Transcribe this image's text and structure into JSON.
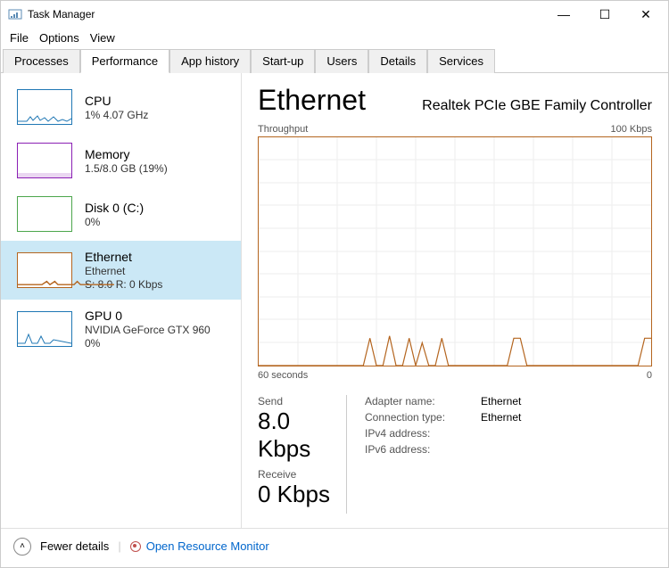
{
  "window": {
    "title": "Task Manager",
    "controls": {
      "min": "—",
      "max": "☐",
      "close": "✕"
    }
  },
  "menu": {
    "file": "File",
    "options": "Options",
    "view": "View"
  },
  "tabs": {
    "processes": "Processes",
    "performance": "Performance",
    "app_history": "App history",
    "startup": "Start-up",
    "users": "Users",
    "details": "Details",
    "services": "Services"
  },
  "sidebar": {
    "cpu": {
      "title": "CPU",
      "sub": "1%  4.07 GHz"
    },
    "memory": {
      "title": "Memory",
      "sub": "1.5/8.0 GB (19%)"
    },
    "disk": {
      "title": "Disk 0 (C:)",
      "sub": "0%"
    },
    "ethernet": {
      "title": "Ethernet",
      "sub1": "Ethernet",
      "sub2": "S: 8.0  R: 0 Kbps"
    },
    "gpu": {
      "title": "GPU 0",
      "sub1": "NVIDIA GeForce GTX 960",
      "sub2": "0%"
    }
  },
  "main": {
    "title": "Ethernet",
    "adapter": "Realtek PCIe GBE Family Controller",
    "chart_top_left": "Throughput",
    "chart_top_right": "100 Kbps",
    "chart_bottom_left": "60 seconds",
    "chart_bottom_right": "0",
    "send_label": "Send",
    "send_value": "8.0 Kbps",
    "receive_label": "Receive",
    "receive_value": "0 Kbps",
    "info": {
      "adapter_name_label": "Adapter name:",
      "adapter_name": "Ethernet",
      "conn_type_label": "Connection type:",
      "conn_type": "Ethernet",
      "ipv4_label": "IPv4 address:",
      "ipv4": "",
      "ipv6_label": "IPv6 address:",
      "ipv6": ""
    }
  },
  "footer": {
    "fewer": "Fewer details",
    "resource_monitor": "Open Resource Monitor"
  },
  "chart_data": {
    "type": "line",
    "title": "Throughput",
    "xlabel": "60 seconds",
    "ylabel": "",
    "ylim": [
      0,
      100
    ],
    "x_range": [
      60,
      0
    ],
    "series": [
      {
        "name": "Send",
        "color": "#b4651f",
        "x": [
          60,
          44,
          43,
          42,
          41,
          40,
          39,
          38,
          37,
          36,
          35,
          34,
          33,
          32,
          31,
          22,
          21,
          20,
          19,
          18,
          2,
          1,
          0
        ],
        "values": [
          0,
          0,
          12,
          0,
          0,
          13,
          0,
          0,
          12,
          0,
          10,
          0,
          0,
          12,
          0,
          0,
          12,
          12,
          0,
          0,
          0,
          12,
          12
        ]
      },
      {
        "name": "Receive",
        "color": "#b4651f",
        "x": [
          60,
          0
        ],
        "values": [
          0,
          0
        ]
      }
    ]
  }
}
